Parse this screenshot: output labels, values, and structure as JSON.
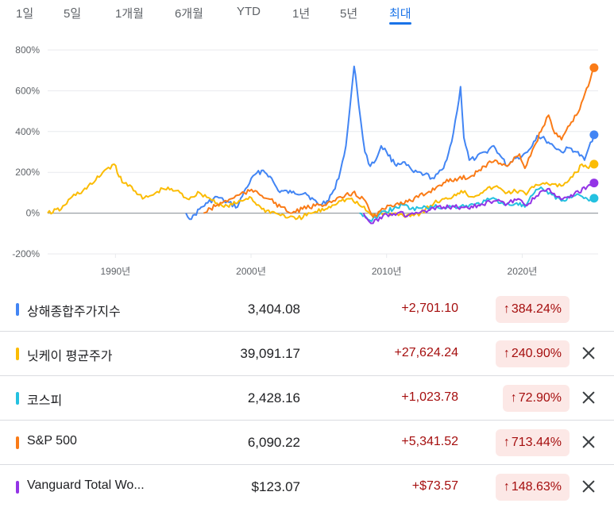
{
  "range_tabs": [
    {
      "label": "1일",
      "active": false
    },
    {
      "label": "5일",
      "active": false
    },
    {
      "label": "1개월",
      "active": false
    },
    {
      "label": "6개월",
      "active": false
    },
    {
      "label": "YTD",
      "active": false
    },
    {
      "label": "1년",
      "active": false
    },
    {
      "label": "5년",
      "active": false
    },
    {
      "label": "최대",
      "active": true
    }
  ],
  "colors": {
    "accent": "#1a73e8",
    "negative": "#a50e0e",
    "negative_bg": "#fce8e6",
    "grid": "#e8eaed",
    "zero_line": "#9aa0a6"
  },
  "chart_data": {
    "type": "line",
    "y_tick_labels": [
      "800%",
      "600%",
      "400%",
      "200%",
      "0%",
      "-200%"
    ],
    "x_tick_labels": [
      "1990년",
      "2000년",
      "2010년",
      "2020년"
    ],
    "xlim": [
      1985.0,
      2025.6
    ],
    "ylim": [
      -200,
      800
    ],
    "grid": true,
    "series": [
      {
        "name": "상해종합주가지수",
        "color": "#4285f4",
        "x": [
          1995.2,
          1995.6,
          1996.2,
          1996.8,
          1997.5,
          1998.0,
          1999.0,
          1999.6,
          2000.3,
          2000.9,
          2001.4,
          2002.0,
          2003.0,
          2004.0,
          2005.0,
          2005.6,
          2006.2,
          2006.6,
          2007.0,
          2007.3,
          2007.6,
          2007.8,
          2008.1,
          2008.4,
          2008.8,
          2009.2,
          2009.6,
          2010.0,
          2010.6,
          2011.2,
          2012.0,
          2012.8,
          2013.5,
          2014.2,
          2014.8,
          2015.2,
          2015.45,
          2015.7,
          2016.1,
          2016.6,
          2017.3,
          2017.9,
          2018.3,
          2018.9,
          2019.4,
          2020.0,
          2020.5,
          2021.1,
          2021.7,
          2022.3,
          2022.9,
          2023.5,
          2024.0,
          2024.6,
          2024.9,
          2025.3
        ],
        "values": [
          0,
          -30,
          20,
          50,
          80,
          60,
          30,
          120,
          190,
          210,
          180,
          110,
          100,
          100,
          40,
          60,
          120,
          210,
          330,
          520,
          720,
          620,
          450,
          300,
          230,
          260,
          330,
          300,
          240,
          250,
          200,
          190,
          170,
          220,
          350,
          500,
          620,
          370,
          260,
          270,
          300,
          330,
          290,
          230,
          270,
          280,
          310,
          380,
          360,
          330,
          300,
          320,
          300,
          260,
          320,
          384
        ]
      },
      {
        "name": "닛케이 평균주가",
        "color": "#fbbc04",
        "x": [
          1985.0,
          1986.0,
          1986.8,
          1987.6,
          1988.4,
          1989.2,
          1989.9,
          1990.5,
          1991.2,
          1992.0,
          1992.8,
          1993.5,
          1994.5,
          1995.3,
          1996.2,
          1997.0,
          1998.0,
          1999.0,
          1999.9,
          2000.8,
          2001.8,
          2002.8,
          2003.3,
          2004.5,
          2005.5,
          2006.5,
          2007.3,
          2008.2,
          2008.9,
          2009.6,
          2010.5,
          2011.5,
          2012.5,
          2013.5,
          2014.5,
          2015.5,
          2016.3,
          2017.2,
          2018.0,
          2018.9,
          2019.8,
          2020.3,
          2021.0,
          2021.8,
          2022.6,
          2023.3,
          2024.0,
          2024.4,
          2024.9,
          2025.3
        ],
        "values": [
          0,
          20,
          80,
          110,
          150,
          210,
          240,
          150,
          130,
          70,
          90,
          120,
          110,
          70,
          100,
          70,
          30,
          50,
          80,
          20,
          0,
          -20,
          -30,
          0,
          20,
          60,
          70,
          30,
          -10,
          0,
          -5,
          -10,
          0,
          50,
          70,
          110,
          80,
          110,
          130,
          100,
          110,
          90,
          140,
          150,
          130,
          150,
          200,
          240,
          220,
          240
        ]
      },
      {
        "name": "코스피",
        "color": "#24c1e0",
        "x": [
          2008.0,
          2008.5,
          2008.9,
          2009.4,
          2009.9,
          2010.5,
          2011.2,
          2011.8,
          2012.5,
          2013.5,
          2014.5,
          2015.5,
          2016.5,
          2017.3,
          2018.0,
          2018.8,
          2019.6,
          2020.2,
          2020.9,
          2021.5,
          2022.2,
          2022.9,
          2023.5,
          2024.2,
          2024.8,
          2025.3
        ],
        "values": [
          0,
          -20,
          -40,
          -10,
          10,
          20,
          40,
          20,
          25,
          30,
          30,
          35,
          40,
          60,
          70,
          40,
          50,
          30,
          100,
          120,
          90,
          60,
          80,
          90,
          70,
          73
        ]
      },
      {
        "name": "S&P 500",
        "color": "#fa7b17",
        "x": [
          1996.5,
          1997.5,
          1998.5,
          1999.5,
          2000.3,
          2001.3,
          2002.2,
          2002.9,
          2003.8,
          2005.0,
          2006.2,
          2007.5,
          2008.3,
          2009.0,
          2009.8,
          2010.8,
          2011.8,
          2013.0,
          2014.2,
          2015.3,
          2016.2,
          2017.2,
          2018.0,
          2018.9,
          2019.8,
          2020.2,
          2020.9,
          2021.5,
          2021.95,
          2022.4,
          2022.9,
          2023.5,
          2024.0,
          2024.5,
          2025.0,
          2025.3
        ],
        "values": [
          0,
          40,
          70,
          100,
          110,
          70,
          30,
          0,
          20,
          40,
          60,
          100,
          70,
          -20,
          20,
          50,
          60,
          100,
          150,
          170,
          180,
          230,
          260,
          230,
          290,
          220,
          330,
          420,
          480,
          390,
          360,
          430,
          480,
          560,
          650,
          713
        ]
      },
      {
        "name": "Vanguard Total Wo...",
        "color": "#9334e6",
        "x": [
          2008.3,
          2008.7,
          2009.0,
          2009.5,
          2010.0,
          2010.8,
          2011.6,
          2012.3,
          2013.2,
          2014.2,
          2015.0,
          2016.0,
          2017.0,
          2018.0,
          2018.9,
          2019.7,
          2020.2,
          2020.9,
          2021.6,
          2022.0,
          2022.6,
          2023.0,
          2023.6,
          2024.2,
          2024.8,
          2025.3
        ],
        "values": [
          0,
          -40,
          -50,
          -20,
          -5,
          0,
          -10,
          0,
          15,
          30,
          30,
          25,
          45,
          60,
          45,
          70,
          40,
          70,
          110,
          120,
          80,
          70,
          90,
          100,
          130,
          148
        ]
      }
    ]
  },
  "legend": [
    {
      "name": "상해종합주가지수",
      "color": "#4285f4",
      "price": "3,404.08",
      "change": "+2,701.10",
      "pct": "384.24%",
      "removable": false
    },
    {
      "name": "닛케이 평균주가",
      "color": "#fbbc04",
      "price": "39,091.17",
      "change": "+27,624.24",
      "pct": "240.90%",
      "removable": true
    },
    {
      "name": "코스피",
      "color": "#24c1e0",
      "price": "2,428.16",
      "change": "+1,023.78",
      "pct": "72.90%",
      "removable": true
    },
    {
      "name": "S&P 500",
      "color": "#fa7b17",
      "price": "6,090.22",
      "change": "+5,341.52",
      "pct": "713.44%",
      "removable": true
    },
    {
      "name": "Vanguard Total Wo...",
      "color": "#9334e6",
      "price": "$123.07",
      "change": "+$73.57",
      "pct": "148.63%",
      "removable": true
    }
  ],
  "arrow_glyph": "↑",
  "close_icon": "close-icon"
}
